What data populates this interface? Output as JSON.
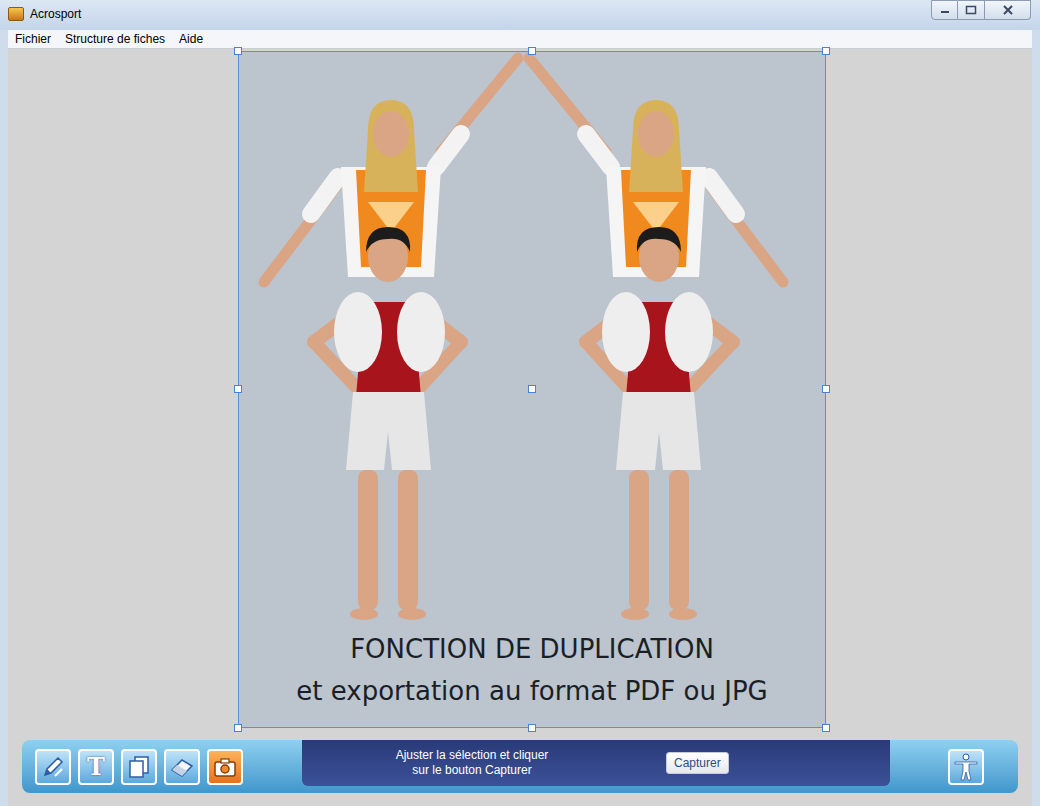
{
  "window": {
    "title": "Acrosport"
  },
  "menu": [
    {
      "label": "Fichier"
    },
    {
      "label": "Structure de fiches"
    },
    {
      "label": "Aide"
    }
  ],
  "canvas": {
    "figures": [
      {
        "mirrored": false
      },
      {
        "mirrored": true
      }
    ],
    "texts": [
      "FONCTION DE DUPLICATION",
      "et exportation au format PDF ou JPG"
    ]
  },
  "toolbar": {
    "tools": [
      {
        "kind": "pen",
        "selected": false
      },
      {
        "kind": "text",
        "label": "T",
        "selected": false
      },
      {
        "kind": "duplicate",
        "selected": false
      },
      {
        "kind": "eraser",
        "selected": false
      },
      {
        "kind": "capture",
        "selected": true
      }
    ],
    "message": [
      "Ajuster la sélection et cliquer",
      "sur le bouton Capturer"
    ],
    "button": "Capturer",
    "right_tool": {
      "kind": "figure"
    }
  }
}
